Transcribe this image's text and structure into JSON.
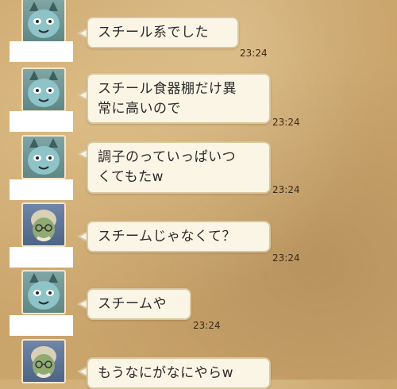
{
  "messages": [
    {
      "text": "スチール系でした",
      "time": "23:24",
      "avatar": "cat-face-icon"
    },
    {
      "text": "スチール食器棚だけ異\n常に高いので",
      "time": "23:24",
      "avatar": "cat-face-icon"
    },
    {
      "text": "調子のっていっぱいつ\nくてもたw",
      "time": "23:24",
      "avatar": "cat-face-icon"
    },
    {
      "text": "スチームじゃなくて？",
      "time": "23:24",
      "avatar": "old-man-icon"
    },
    {
      "text": "スチームや",
      "time": "23:24",
      "avatar": "cat-face-icon"
    },
    {
      "text": "もうなにがなにやらw",
      "time": "",
      "avatar": "old-man-icon"
    }
  ],
  "colors": {
    "background": "#c9a46b",
    "bubble": "#fbf5e6",
    "bubble_border": "#d9c7a0"
  }
}
